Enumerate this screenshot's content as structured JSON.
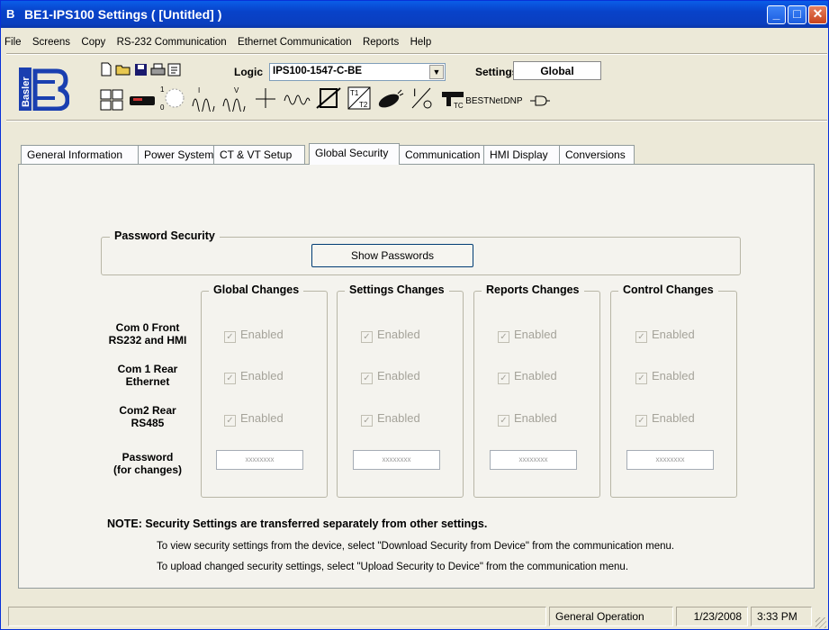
{
  "window": {
    "title": "BE1-IPS100 Settings    ( [Untitled] )",
    "min_label": "_",
    "max_label": "□",
    "close_label": "✕"
  },
  "menu": [
    "File",
    "Screens",
    "Copy",
    "RS-232 Communication",
    "Ethernet Communication",
    "Reports",
    "Help"
  ],
  "toolbar": {
    "logo_text": "Basler",
    "logic_label": "Logic",
    "logic_value": "IPS100-1547-C-BE",
    "settings_label": "Settings",
    "settings_value": "Global",
    "bestnet_label": "BESTNet",
    "dnp_label": "DNP",
    "icons": [
      "new-file-icon",
      "open-folder-icon",
      "save-icon",
      "print-icon",
      "properties-icon",
      "matrix-icon",
      "relay-device-icon",
      "phase-rotation-icon",
      "current-waveform-icon",
      "voltage-waveform-icon",
      "phasor-icon",
      "waveform-icon",
      "transfer-function-icon",
      "transformer-icon",
      "satellite-icon",
      "i-over-o-icon",
      "thermal-icon",
      "bestnet-icon",
      "dnp-icon",
      "plug-icon"
    ]
  },
  "tabs": [
    "General Information",
    "Power System",
    "CT & VT Setup",
    "Global Security",
    "Communication",
    "HMI Display",
    "Conversions"
  ],
  "active_tab": "Global Security",
  "password_security": {
    "title": "Password Security",
    "show_button": "Show Passwords"
  },
  "columns": [
    "Global Changes",
    "Settings Changes",
    "Reports Changes",
    "Control Changes"
  ],
  "rows": [
    {
      "label_line1": "Com 0 Front",
      "label_line2": "RS232 and HMI"
    },
    {
      "label_line1": "Com 1 Rear",
      "label_line2": "Ethernet"
    },
    {
      "label_line1": "Com2 Rear",
      "label_line2": "RS485"
    }
  ],
  "checkbox_label": "Enabled",
  "password_row": {
    "label_line1": "Password",
    "label_line2": "(for changes)",
    "mask": "xxxxxxxx"
  },
  "note": {
    "heading": "NOTE:  Security Settings are transferred separately from other settings.",
    "line1": "To view security settings from the device, select \"Download Security from Device\" from the communication menu.",
    "line2": "To upload changed security settings, select \"Upload Security to Device\" from the communication menu."
  },
  "status": {
    "mode": "General Operation",
    "date": "1/23/2008",
    "time": "3:33 PM"
  }
}
